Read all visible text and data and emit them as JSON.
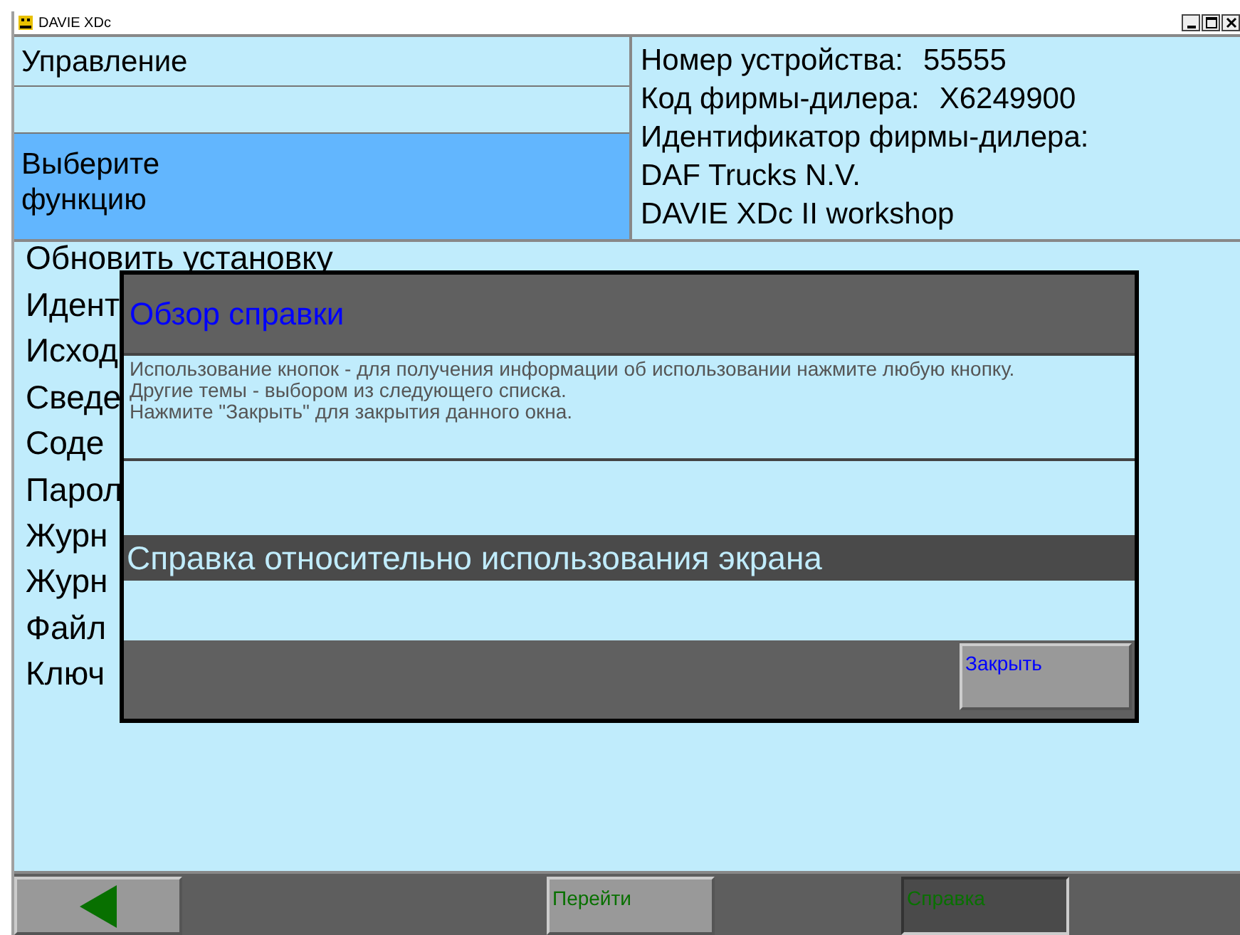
{
  "window": {
    "title": "DAVIE XDc"
  },
  "header": {
    "section": "Управление",
    "prompt": "Выберите функцию",
    "info": [
      {
        "label": "Номер устройства:",
        "value": "55555"
      },
      {
        "label": "Код фирмы-дилера:",
        "value": "X6249900"
      },
      {
        "label": "Идентификатор фирмы-дилера:"
      },
      {
        "label": "DAF Trucks N.V."
      },
      {
        "label": "DAVIE XDc II workshop"
      }
    ]
  },
  "menu": [
    "Обновить установку",
    "Идент",
    "Исход",
    "Сведе",
    "Соде",
    "Парол",
    "Журн",
    "Журн",
    "Файл",
    "Ключ"
  ],
  "dialog": {
    "title": "Обзор справки",
    "text": [
      "Использование кнопок - для получения информации об использовании нажмите любую кнопку.",
      "Другие темы - выбором из следующего списка.",
      "Нажмите \"Закрыть\" для закрытия данного окна."
    ],
    "topics": [
      {
        "label": "Справка относительно использования экрана",
        "selected": true
      }
    ],
    "close_button": "Закрыть"
  },
  "toolbar": [
    {
      "kind": "back",
      "selected": false
    },
    {
      "kind": "text",
      "label": "Перейти",
      "selected": false
    },
    {
      "kind": "text",
      "label": "Справка",
      "selected": true
    }
  ]
}
